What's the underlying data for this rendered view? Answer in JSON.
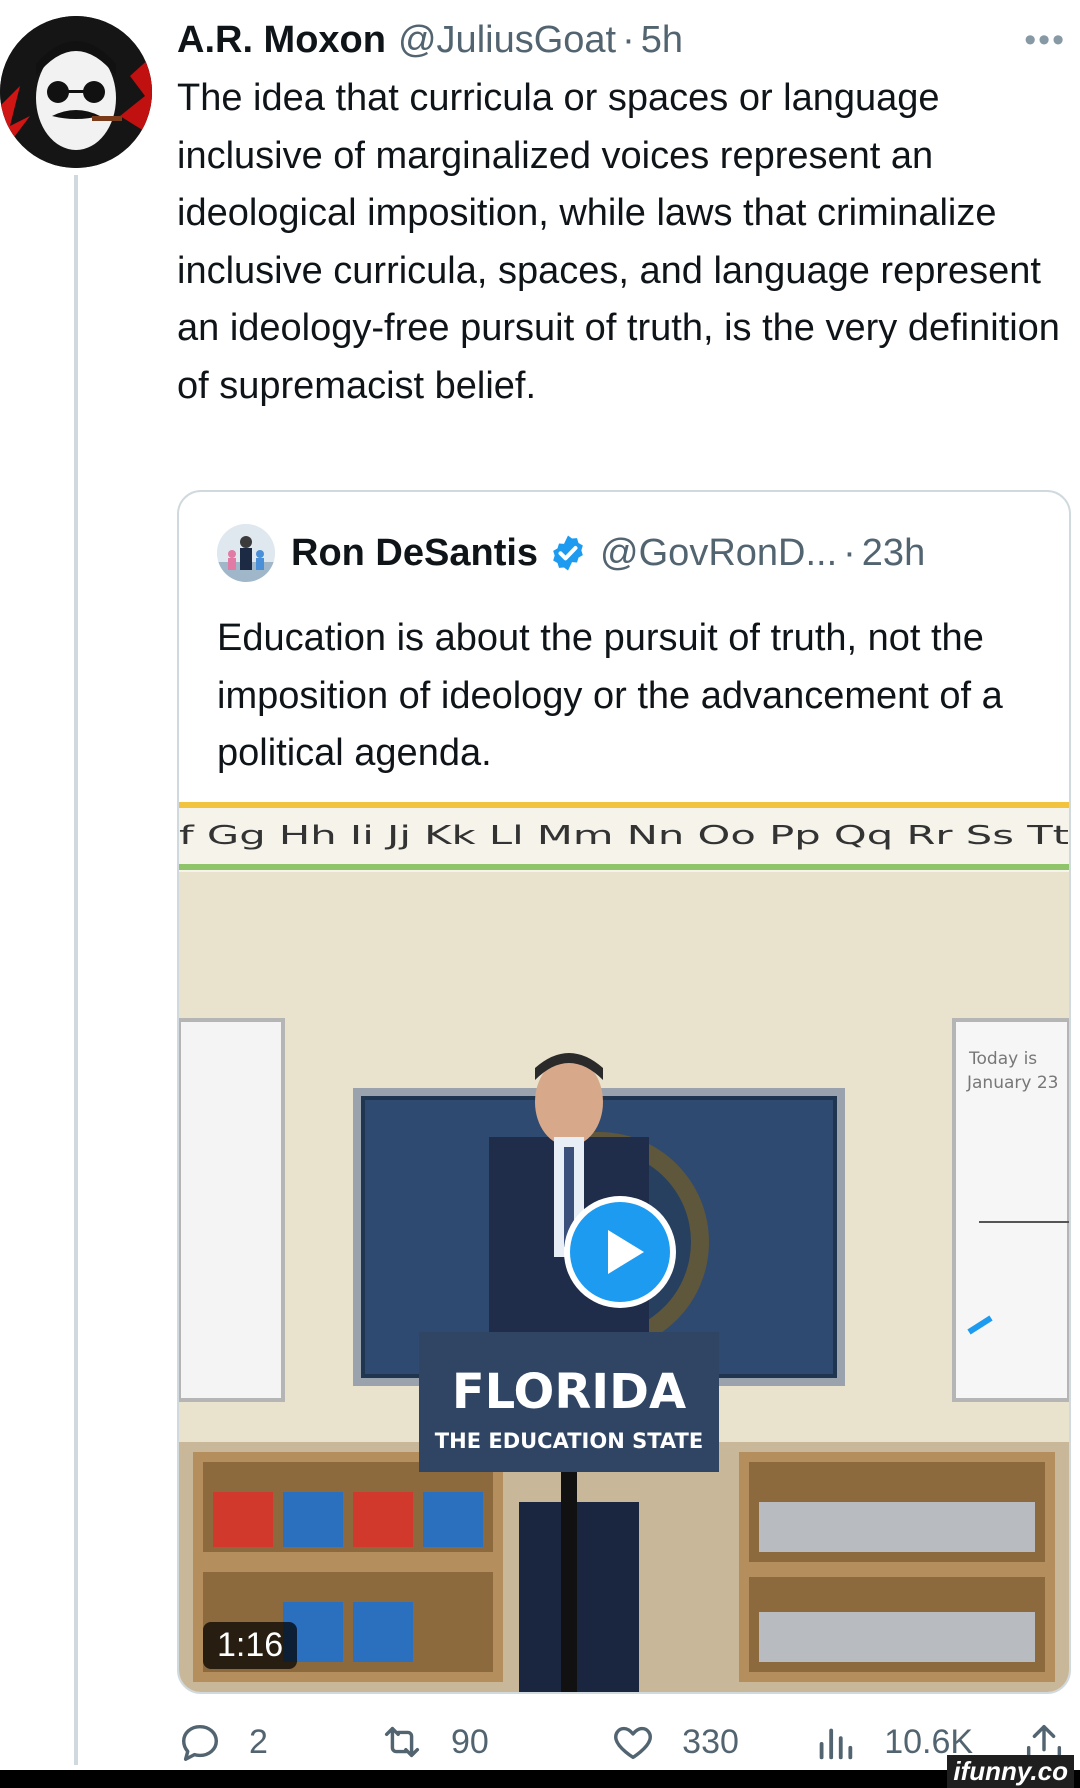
{
  "tweet": {
    "name": "A.R. Moxon",
    "handle": "@JuliusGoat",
    "dot": "·",
    "time": "5h",
    "more": "•••",
    "text": "The idea that curricula or spaces or language inclusive of marginalized voices represent an ideological imposition, while laws that criminalize inclusive curricula, spaces, and language represent an ideology-free pursuit of truth, is the very definition of supremacist belief."
  },
  "quote": {
    "name": "Ron DeSantis",
    "handle": "@GovRonD...",
    "dot": "·",
    "time": "23h",
    "text": "Education is about the pursuit of truth, not the imposition of ideology or the advancement of a political agenda.",
    "media": {
      "alphabet": "f Gg Hh Ii Jj Kk Ll Mm Nn Oo Pp Qq Rr Ss Tt",
      "podium_line1": "FLORIDA",
      "podium_line2": "THE EDUCATION STATE",
      "board_text1": "Today is",
      "board_text2": "January 23",
      "duration": "1:16"
    }
  },
  "actions": {
    "replies": "2",
    "retweets": "90",
    "likes": "330",
    "views": "10.6K"
  },
  "watermark": "ifunny.co",
  "colors": {
    "verified": "#1d9bf0",
    "play": "#1d9bf0",
    "muted": "#536471"
  }
}
